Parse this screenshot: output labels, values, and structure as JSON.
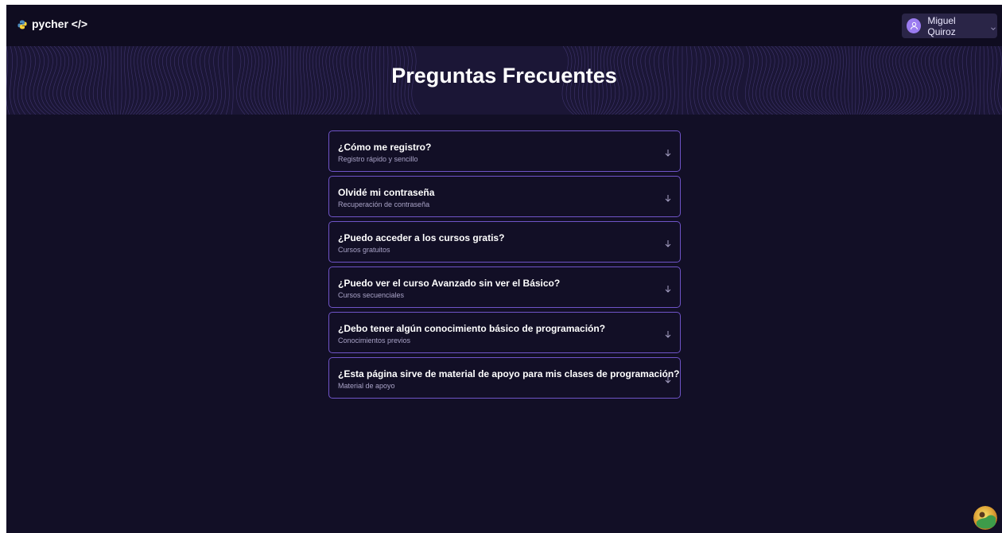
{
  "app": {
    "logo_text": "pycher </>",
    "logo_icon": "python-icon"
  },
  "user": {
    "name": "Miguel Quiroz",
    "avatar_icon": "user-icon",
    "menu_icon": "chevron-down-icon"
  },
  "hero": {
    "title": "Preguntas Frecuentes"
  },
  "faq": {
    "items": [
      {
        "question": "¿Cómo me registro?",
        "subtitle": "Registro rápido y sencillo"
      },
      {
        "question": "Olvidé mi contraseña",
        "subtitle": "Recuperación de contraseña"
      },
      {
        "question": "¿Puedo acceder a los cursos gratis?",
        "subtitle": "Cursos gratuitos"
      },
      {
        "question": "¿Puedo ver el curso Avanzado sin ver el Básico?",
        "subtitle": "Cursos secuenciales"
      },
      {
        "question": "¿Debo tener algún conocimiento básico de programación?",
        "subtitle": "Conocimientos previos"
      },
      {
        "question": "¿Esta página sirve de material de apoyo para mis clases de programación?",
        "subtitle": "Material de apoyo"
      }
    ]
  },
  "colors": {
    "background": "#120f26",
    "topbar": "#0f0c20",
    "accent_border": "#6f54c7",
    "avatar": "#9b7cf0"
  }
}
